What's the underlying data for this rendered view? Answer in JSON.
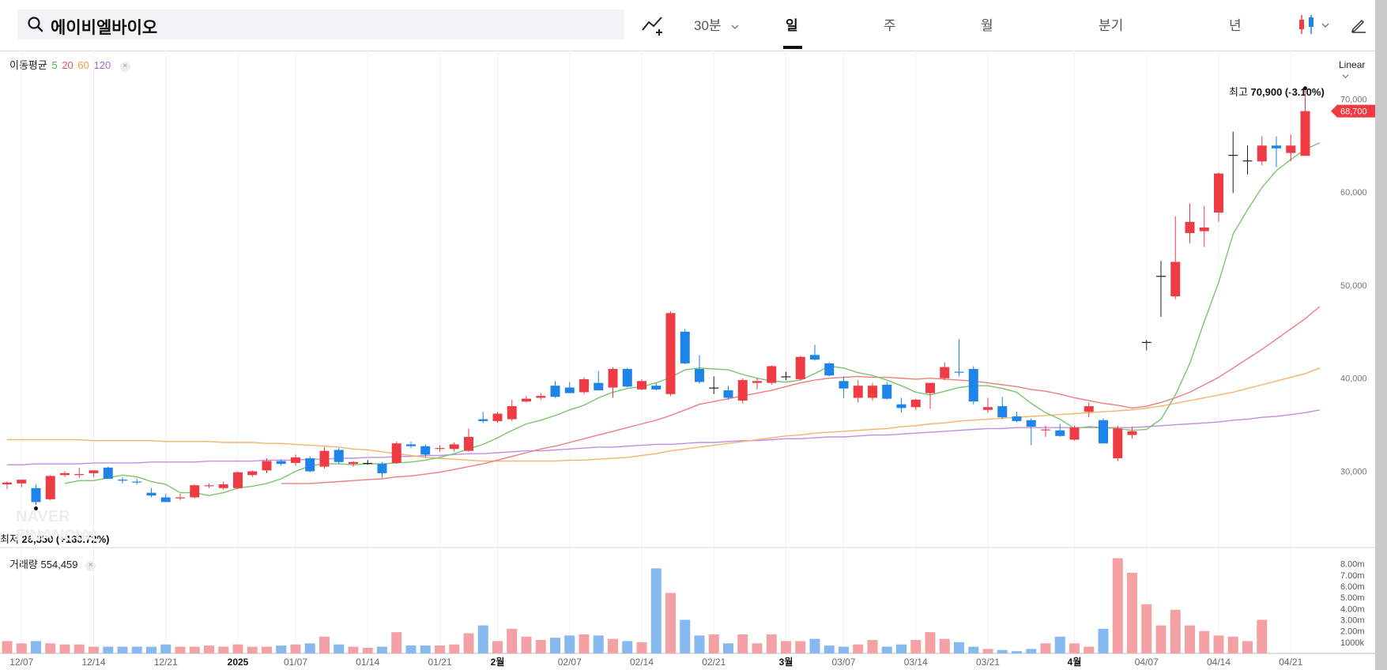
{
  "search": {
    "query": "에이비엘바이오"
  },
  "toolbar": {
    "interval_label": "30분",
    "tabs": [
      {
        "label": "일",
        "active": true
      },
      {
        "label": "주",
        "active": false
      },
      {
        "label": "월",
        "active": false
      },
      {
        "label": "분기",
        "active": false
      },
      {
        "label": "년",
        "active": false
      }
    ]
  },
  "indicator_legend": {
    "label": "이동평균",
    "periods": [
      {
        "value": "5",
        "color": "#4cae4c"
      },
      {
        "value": "20",
        "color": "#e8535a"
      },
      {
        "value": "60",
        "color": "#f39c3c"
      },
      {
        "value": "120",
        "color": "#a569d6"
      }
    ]
  },
  "price_scale": {
    "mode": "Linear"
  },
  "annotations": {
    "high_label": "최고",
    "high_value": "70,900 (-3.10%)",
    "low_label": "최저",
    "low_value": "26,350 (+160.72%)",
    "current_price": "68,700"
  },
  "volume_legend": {
    "label": "거래량",
    "value": "554,459"
  },
  "colors": {
    "up": "#ef3b43",
    "down": "#1e84e9",
    "up_vol": "#f4a1a5",
    "down_vol": "#85b9f0",
    "ma5": "#7cc46e",
    "ma20": "#ec7f7f",
    "ma60": "#f5b36f",
    "ma120": "#c08fe3"
  },
  "chart_data": {
    "type": "candlestick",
    "price_ylim": [
      23000,
      73000
    ],
    "price_ticks": [
      "30,000",
      "40,000",
      "50,000",
      "60,000",
      "70,000"
    ],
    "volume_ticks": [
      "1000k",
      "2.00m",
      "3.00m",
      "4.00m",
      "5.00m",
      "6.00m",
      "7.00m",
      "8.00m"
    ],
    "x_labels": [
      "12/07",
      "12/14",
      "12/21",
      "2025",
      "01/07",
      "01/14",
      "01/21",
      "2월",
      "02/07",
      "02/14",
      "02/21",
      "3월",
      "03/07",
      "03/14",
      "03/21",
      "4월",
      "04/07",
      "04/14",
      "04/21"
    ],
    "x_label_index": [
      1,
      6,
      11,
      16,
      20,
      25,
      30,
      34,
      39,
      44,
      49,
      54,
      58,
      63,
      68,
      74,
      79,
      84,
      89
    ],
    "candles": [
      [
        28600,
        28900,
        28100,
        28800
      ],
      [
        28700,
        29100,
        28300,
        29100
      ],
      [
        28200,
        28600,
        26350,
        26700
      ],
      [
        27000,
        29600,
        26900,
        29500
      ],
      [
        29600,
        30000,
        29400,
        29800
      ],
      [
        29600,
        30400,
        29300,
        29700
      ],
      [
        29800,
        30100,
        29400,
        30100
      ],
      [
        30400,
        30500,
        29200,
        29200
      ],
      [
        29100,
        29400,
        28700,
        29000
      ],
      [
        28900,
        29200,
        28600,
        28800
      ],
      [
        27700,
        28200,
        27200,
        27400
      ],
      [
        27200,
        27600,
        26700,
        26700
      ],
      [
        27100,
        27600,
        26900,
        27200
      ],
      [
        27200,
        28600,
        27100,
        28500
      ],
      [
        28400,
        28700,
        28200,
        28500
      ],
      [
        28200,
        28900,
        28000,
        28600
      ],
      [
        28200,
        30000,
        28100,
        29900
      ],
      [
        29600,
        30100,
        29400,
        30000
      ],
      [
        30100,
        31400,
        29800,
        31100
      ],
      [
        31100,
        31300,
        30600,
        30800
      ],
      [
        30900,
        31800,
        30600,
        31500
      ],
      [
        31400,
        31600,
        29900,
        30000
      ],
      [
        30500,
        32600,
        30300,
        32200
      ],
      [
        32300,
        32500,
        30800,
        31000
      ],
      [
        30800,
        31100,
        30500,
        31000
      ],
      [
        30900,
        31200,
        30700,
        30900
      ],
      [
        30800,
        31000,
        29300,
        29800
      ],
      [
        30900,
        33200,
        30800,
        33000
      ],
      [
        32900,
        33200,
        32500,
        32700
      ],
      [
        32700,
        32900,
        31500,
        31800
      ],
      [
        32400,
        32800,
        32100,
        32500
      ],
      [
        32400,
        33100,
        32100,
        32900
      ],
      [
        32200,
        34600,
        32100,
        33700
      ],
      [
        35600,
        36400,
        35200,
        35400
      ],
      [
        35400,
        36400,
        35200,
        36200
      ],
      [
        35600,
        37700,
        35400,
        37000
      ],
      [
        37500,
        38100,
        37400,
        37800
      ],
      [
        37900,
        38400,
        37700,
        38100
      ],
      [
        39200,
        39700,
        37900,
        38000
      ],
      [
        39000,
        39600,
        38400,
        38400
      ],
      [
        38500,
        40100,
        38300,
        39900
      ],
      [
        39500,
        40800,
        38800,
        38700
      ],
      [
        39000,
        41200,
        37900,
        41000
      ],
      [
        41000,
        41100,
        39000,
        39100
      ],
      [
        38800,
        39900,
        38700,
        39700
      ],
      [
        39200,
        39500,
        38700,
        38800
      ],
      [
        38300,
        47200,
        38100,
        47000
      ],
      [
        45000,
        45300,
        41500,
        41600
      ],
      [
        41000,
        42500,
        39400,
        39600
      ],
      [
        39000,
        40200,
        38300,
        39000
      ],
      [
        38700,
        39200,
        37700,
        37900
      ],
      [
        37600,
        40000,
        37300,
        39800
      ],
      [
        39500,
        40000,
        38800,
        39700
      ],
      [
        39500,
        41400,
        39300,
        41300
      ],
      [
        40200,
        40700,
        39800,
        40200
      ],
      [
        39900,
        42400,
        39800,
        42300
      ],
      [
        42500,
        43600,
        41900,
        42000
      ],
      [
        41600,
        41700,
        40200,
        40300
      ],
      [
        39700,
        40200,
        37900,
        38900
      ],
      [
        37900,
        39800,
        37400,
        39200
      ],
      [
        37900,
        39500,
        37600,
        39200
      ],
      [
        39300,
        39600,
        37700,
        37800
      ],
      [
        37200,
        37900,
        36300,
        36800
      ],
      [
        36900,
        37800,
        36600,
        37700
      ],
      [
        38400,
        39500,
        36700,
        39500
      ],
      [
        40000,
        41700,
        39800,
        41200
      ],
      [
        40700,
        44200,
        40200,
        40600
      ],
      [
        41000,
        41300,
        37200,
        37500
      ],
      [
        36600,
        37900,
        36300,
        36900
      ],
      [
        37000,
        38000,
        35600,
        35800
      ],
      [
        35900,
        36400,
        35300,
        35400
      ],
      [
        35500,
        35700,
        32800,
        34800
      ],
      [
        34400,
        34900,
        33700,
        34500
      ],
      [
        34400,
        35100,
        33700,
        33800
      ],
      [
        33400,
        34900,
        33300,
        34700
      ],
      [
        36400,
        37400,
        35800,
        37000
      ],
      [
        35500,
        35700,
        33000,
        33000
      ],
      [
        31400,
        34900,
        31100,
        34600
      ],
      [
        33900,
        34800,
        33500,
        34300
      ],
      [
        43900,
        44100,
        43000,
        43900
      ],
      [
        51000,
        52600,
        46600,
        51000
      ],
      [
        48800,
        57400,
        48500,
        52500
      ],
      [
        55600,
        58800,
        54500,
        56800
      ],
      [
        55800,
        58500,
        54100,
        56200
      ],
      [
        57800,
        62100,
        56800,
        62000
      ],
      [
        64000,
        66500,
        59900,
        64000
      ],
      [
        63400,
        65000,
        61900,
        63400
      ],
      [
        63300,
        66000,
        62900,
        65000
      ],
      [
        65000,
        66000,
        62700,
        64700
      ],
      [
        64200,
        66200,
        63300,
        65000
      ],
      [
        63900,
        70900,
        63900,
        68700
      ]
    ],
    "volume_k": [
      1100,
      900,
      1100,
      900,
      800,
      800,
      600,
      600,
      600,
      600,
      600,
      800,
      600,
      600,
      700,
      600,
      800,
      600,
      600,
      700,
      800,
      900,
      1500,
      800,
      600,
      500,
      600,
      1900,
      700,
      700,
      700,
      800,
      1800,
      2500,
      1100,
      2200,
      1500,
      1200,
      1400,
      1600,
      1700,
      1600,
      1300,
      1100,
      1000,
      7600,
      5400,
      3000,
      1600,
      1700,
      900,
      1700,
      900,
      1700,
      1100,
      1100,
      1300,
      700,
      600,
      800,
      1200,
      600,
      800,
      1200,
      1900,
      1300,
      1000,
      600,
      400,
      300,
      200,
      400,
      900,
      1500,
      900,
      600,
      2200,
      8500,
      7200,
      4400,
      2500,
      3900,
      2500,
      2000,
      1600,
      1500,
      1100,
      3000
    ],
    "ma5": [
      null,
      null,
      null,
      null,
      28700,
      29000,
      29000,
      29300,
      29600,
      29400,
      28900,
      28600,
      27700,
      27700,
      27400,
      27700,
      28200,
      28400,
      28700,
      29200,
      30000,
      30600,
      30800,
      30800,
      30700,
      30800,
      30800,
      30900,
      31000,
      31200,
      31500,
      31900,
      32400,
      32900,
      33600,
      34400,
      35100,
      35500,
      36000,
      36600,
      37100,
      37900,
      38500,
      38900,
      39100,
      39500,
      40100,
      40900,
      41100,
      41000,
      40900,
      40400,
      40000,
      39700,
      39600,
      39800,
      40500,
      41300,
      41100,
      40600,
      40300,
      39800,
      39200,
      38500,
      38200,
      38600,
      39000,
      39200,
      39200,
      38900,
      38500,
      37300,
      36300,
      35600,
      34600,
      34800,
      34700,
      34600,
      34400,
      34500,
      35600,
      38200,
      41600,
      46100,
      50300,
      55500,
      58100,
      60500,
      62300,
      63500,
      64600,
      65300
    ],
    "ma20": [
      null,
      null,
      null,
      null,
      null,
      null,
      null,
      null,
      null,
      null,
      null,
      null,
      null,
      null,
      null,
      null,
      null,
      null,
      null,
      28700,
      28700,
      28700,
      28800,
      28900,
      29000,
      29100,
      29200,
      29400,
      29500,
      29700,
      29900,
      30200,
      30500,
      30800,
      31200,
      31600,
      32000,
      32400,
      32700,
      33100,
      33500,
      33900,
      34300,
      34700,
      35100,
      35500,
      36000,
      36600,
      37200,
      37500,
      37800,
      38100,
      38400,
      38700,
      39100,
      39500,
      39800,
      40000,
      40100,
      40200,
      40100,
      40100,
      40000,
      39900,
      40000,
      39900,
      39800,
      39700,
      39500,
      39300,
      39100,
      38800,
      38600,
      38300,
      37900,
      37600,
      37300,
      37100,
      36800,
      37000,
      37400,
      37900,
      38500,
      39300,
      40100,
      41100,
      42100,
      43100,
      44200,
      45300,
      46400,
      47700
    ],
    "ma60": [
      33400,
      33400,
      33400,
      33400,
      33400,
      33400,
      33300,
      33300,
      33300,
      33300,
      33300,
      33200,
      33200,
      33200,
      33200,
      33100,
      33100,
      33100,
      33000,
      33000,
      32900,
      32800,
      32700,
      32600,
      32400,
      32300,
      32100,
      31900,
      31700,
      31500,
      31400,
      31300,
      31200,
      31100,
      31100,
      31100,
      31100,
      31100,
      31100,
      31200,
      31200,
      31300,
      31400,
      31500,
      31700,
      31900,
      32200,
      32400,
      32600,
      32800,
      33000,
      33200,
      33400,
      33600,
      33800,
      33900,
      34100,
      34200,
      34300,
      34400,
      34500,
      34600,
      34800,
      34900,
      35100,
      35200,
      35400,
      35500,
      35600,
      35700,
      35800,
      35900,
      36000,
      36100,
      36200,
      36300,
      36400,
      36500,
      36600,
      36800,
      37000,
      37300,
      37600,
      37900,
      38200,
      38500,
      38900,
      39300,
      39700,
      40100,
      40500,
      41100
    ],
    "ma120": [
      30700,
      30700,
      30800,
      30800,
      30800,
      30800,
      30900,
      30900,
      30900,
      30900,
      31000,
      31000,
      31000,
      31000,
      31100,
      31100,
      31100,
      31100,
      31200,
      31200,
      31200,
      31300,
      31300,
      31400,
      31400,
      31500,
      31500,
      31600,
      31600,
      31700,
      31700,
      31800,
      31900,
      31900,
      32000,
      32100,
      32200,
      32200,
      32300,
      32400,
      32500,
      32600,
      32600,
      32700,
      32800,
      32900,
      32900,
      33000,
      33100,
      33100,
      33200,
      33300,
      33300,
      33400,
      33500,
      33500,
      33600,
      33700,
      33700,
      33800,
      33900,
      33900,
      34000,
      34100,
      34200,
      34300,
      34400,
      34500,
      34600,
      34600,
      34700,
      34700,
      34700,
      34700,
      34700,
      34700,
      34700,
      34700,
      34700,
      34800,
      34900,
      35000,
      35100,
      35200,
      35300,
      35500,
      35600,
      35800,
      35900,
      36100,
      36300,
      36600
    ]
  }
}
